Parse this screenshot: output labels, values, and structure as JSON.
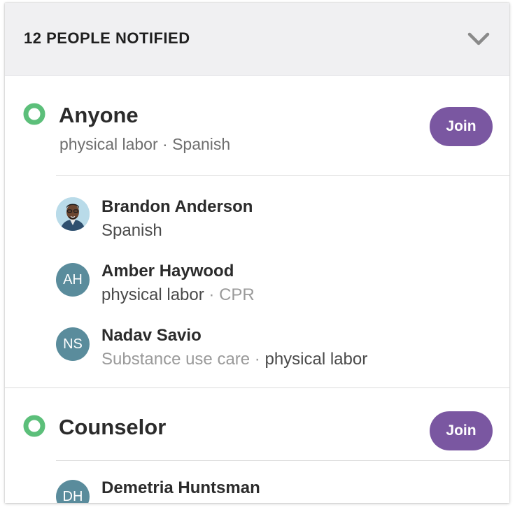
{
  "header": {
    "title": "12 PEOPLE NOTIFIED",
    "toggle_icon": "chevron-down-icon"
  },
  "colors": {
    "accent": "#7a57a1",
    "status_green": "#5cbf7a",
    "avatar_bg": "#5a8c9c",
    "header_bg": "#f0f0f2"
  },
  "groups": [
    {
      "title": "Anyone",
      "subtitle": "physical labor · Spanish",
      "join_label": "Join",
      "people": [
        {
          "name": "Brandon Anderson",
          "initials": "",
          "avatar": "photo",
          "tags": [
            {
              "text": "Spanish",
              "match": true
            }
          ]
        },
        {
          "name": "Amber Haywood",
          "initials": "AH",
          "tags": [
            {
              "text": "physical labor",
              "match": true
            },
            {
              "text": "CPR",
              "match": false
            }
          ]
        },
        {
          "name": "Nadav Savio",
          "initials": "NS",
          "tags": [
            {
              "text": "Substance use care",
              "match": false
            },
            {
              "text": "physical labor",
              "match": true
            }
          ]
        }
      ]
    },
    {
      "title": "Counselor",
      "join_label": "Join",
      "people": [
        {
          "name": "Demetria Huntsman",
          "initials": "DH"
        }
      ]
    }
  ]
}
